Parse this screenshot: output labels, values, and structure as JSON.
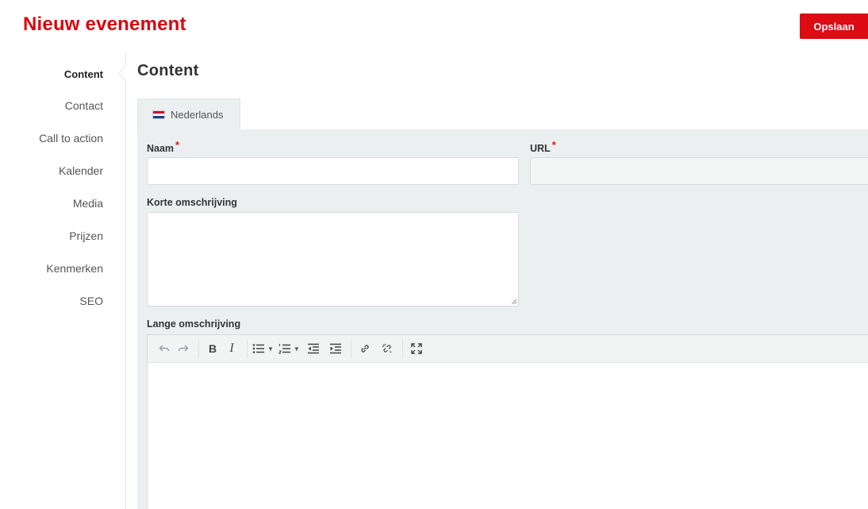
{
  "header": {
    "title": "Nieuw evenement",
    "save_label": "Opslaan"
  },
  "sidebar": {
    "items": [
      {
        "label": "Content",
        "active": true
      },
      {
        "label": "Contact"
      },
      {
        "label": "Call to action"
      },
      {
        "label": "Kalender"
      },
      {
        "label": "Media"
      },
      {
        "label": "Prijzen"
      },
      {
        "label": "Kenmerken"
      },
      {
        "label": "SEO"
      }
    ]
  },
  "section": {
    "title": "Content"
  },
  "tabs": [
    {
      "label": "Nederlands",
      "flag": "nl-flag-icon",
      "active": true
    }
  ],
  "form": {
    "naam": {
      "label": "Naam",
      "required_mark": "*",
      "value": ""
    },
    "url": {
      "label": "URL",
      "required_mark": "*",
      "value": ""
    },
    "korte_omschrijving": {
      "label": "Korte omschrijving",
      "value": ""
    },
    "lange_omschrijving": {
      "label": "Lange omschrijving",
      "value": ""
    }
  },
  "editor_toolbar": [
    "undo-icon",
    "redo-icon",
    "bold-icon",
    "italic-icon",
    "bullet-list-icon",
    "numbered-list-icon",
    "outdent-icon",
    "indent-icon",
    "link-icon",
    "unlink-icon",
    "fullscreen-icon"
  ],
  "colors": {
    "brand": "#dd0b12",
    "panel": "#eceff0",
    "required": "#e0141c"
  }
}
